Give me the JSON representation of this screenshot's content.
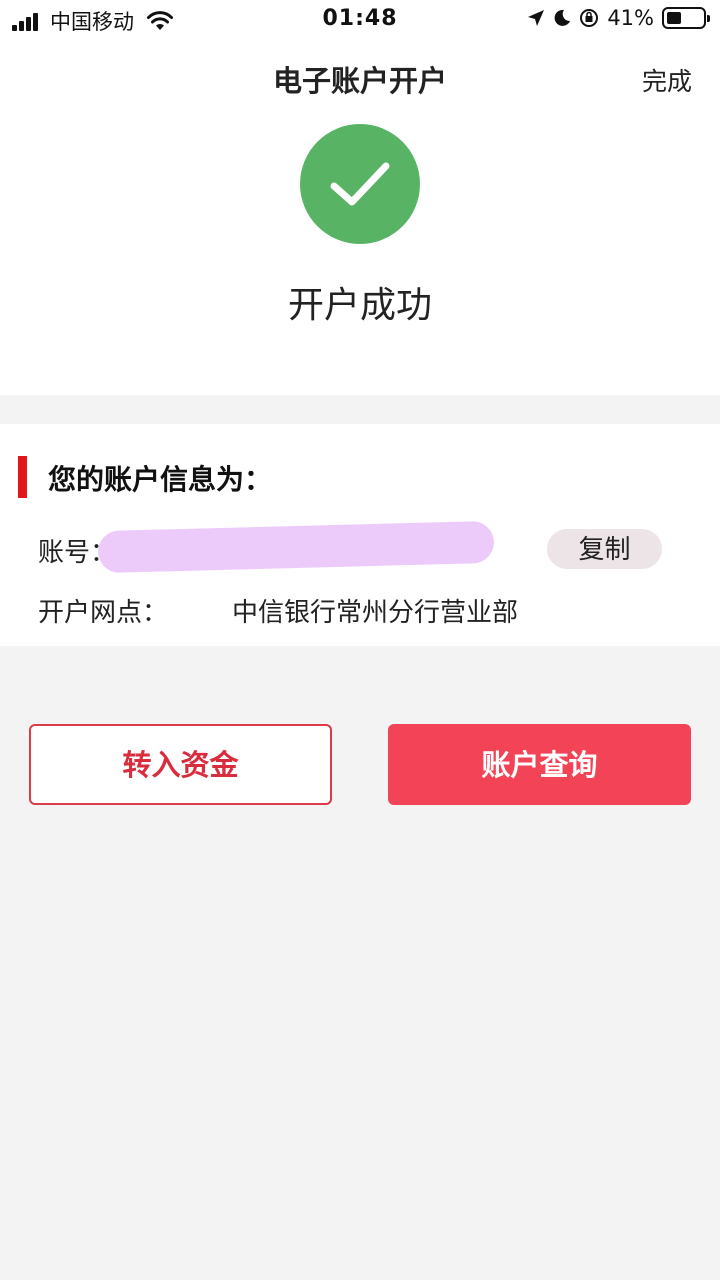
{
  "status_bar": {
    "carrier": "中国移动",
    "time": "01:48",
    "battery": "41%"
  },
  "nav": {
    "title": "电子账户开户",
    "done_label": "完成"
  },
  "success": {
    "message": "开户成功",
    "icon": "check-circle-icon",
    "color": "#58b464"
  },
  "account_info": {
    "heading": "您的账户信息为：",
    "account_label": "账号：",
    "copy_label": "复制",
    "branch_label": "开户网点：",
    "branch_value": "中信银行常州分行营业部"
  },
  "actions": {
    "transfer_in_label": "转入资金",
    "account_query_label": "账户查询"
  },
  "colors": {
    "accent": "#f24456",
    "redact": "#eccbfb"
  }
}
